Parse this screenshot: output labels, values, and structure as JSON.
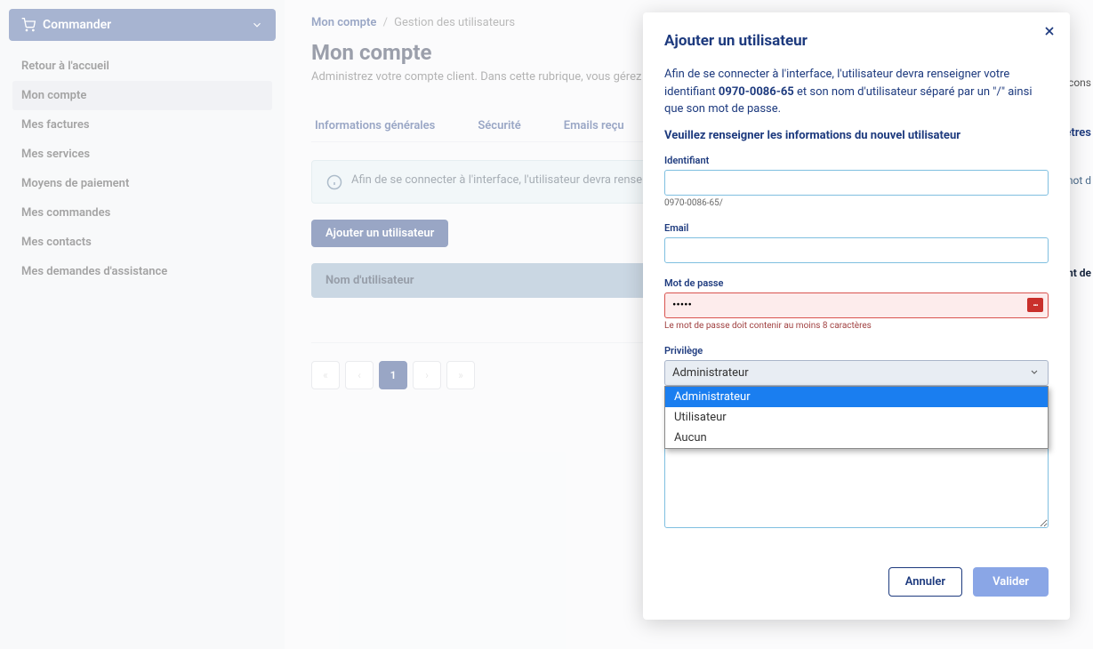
{
  "sidebar": {
    "commander": "Commander",
    "items": [
      {
        "label": "Retour à l'accueil"
      },
      {
        "label": "Mon compte"
      },
      {
        "label": "Mes factures"
      },
      {
        "label": "Mes services"
      },
      {
        "label": "Moyens de paiement"
      },
      {
        "label": "Mes commandes"
      },
      {
        "label": "Mes contacts"
      },
      {
        "label": "Mes demandes d'assistance"
      }
    ]
  },
  "breadcrumb": {
    "root": "Mon compte",
    "current": "Gestion des utilisateurs"
  },
  "page": {
    "title": "Mon compte",
    "subtitle": "Administrez votre compte client. Dans cette rubrique, vous gérez la sé"
  },
  "tabs": [
    {
      "label": "Informations générales"
    },
    {
      "label": "Sécurité"
    },
    {
      "label": "Emails reçu"
    }
  ],
  "banner": "Afin de se connecter à l'interface, l'utilisateur devra renseigne",
  "buttons": {
    "add_user": "Ajouter un utilisateur"
  },
  "table": {
    "header_username": "Nom d'utilisateur"
  },
  "pagination": {
    "first": "«",
    "prev": "‹",
    "current": "1",
    "next": "›",
    "last": "»"
  },
  "modal": {
    "title": "Ajouter un utilisateur",
    "text_pre": "Afin de se connecter à l'interface, l'utilisateur devra renseigner votre identifiant ",
    "identifier": "0970-0086-65",
    "text_post": " et son nom d'utilisateur séparé par un \"/\" ainsi que son mot de passe.",
    "subtitle": "Veuillez renseigner les informations du nouvel utilisateur",
    "fields": {
      "identifiant": {
        "label": "Identifiant",
        "hint": "0970-0086-65/"
      },
      "email": {
        "label": "Email"
      },
      "password": {
        "label": "Mot de passe",
        "value": "•••••",
        "hint": "Le mot de passe doit contenir au moins 8 caractères"
      },
      "privilege": {
        "label": "Privilège",
        "selected": "Administrateur",
        "options": [
          "Administrateur",
          "Utilisateur",
          "Aucun"
        ]
      }
    },
    "actions": {
      "cancel": "Annuler",
      "submit": "Valider"
    }
  },
  "peek": {
    "tab_right": "ètres",
    "banner_right1": "mot d",
    "banner_right2": "cons",
    "header_right": "nt de"
  }
}
